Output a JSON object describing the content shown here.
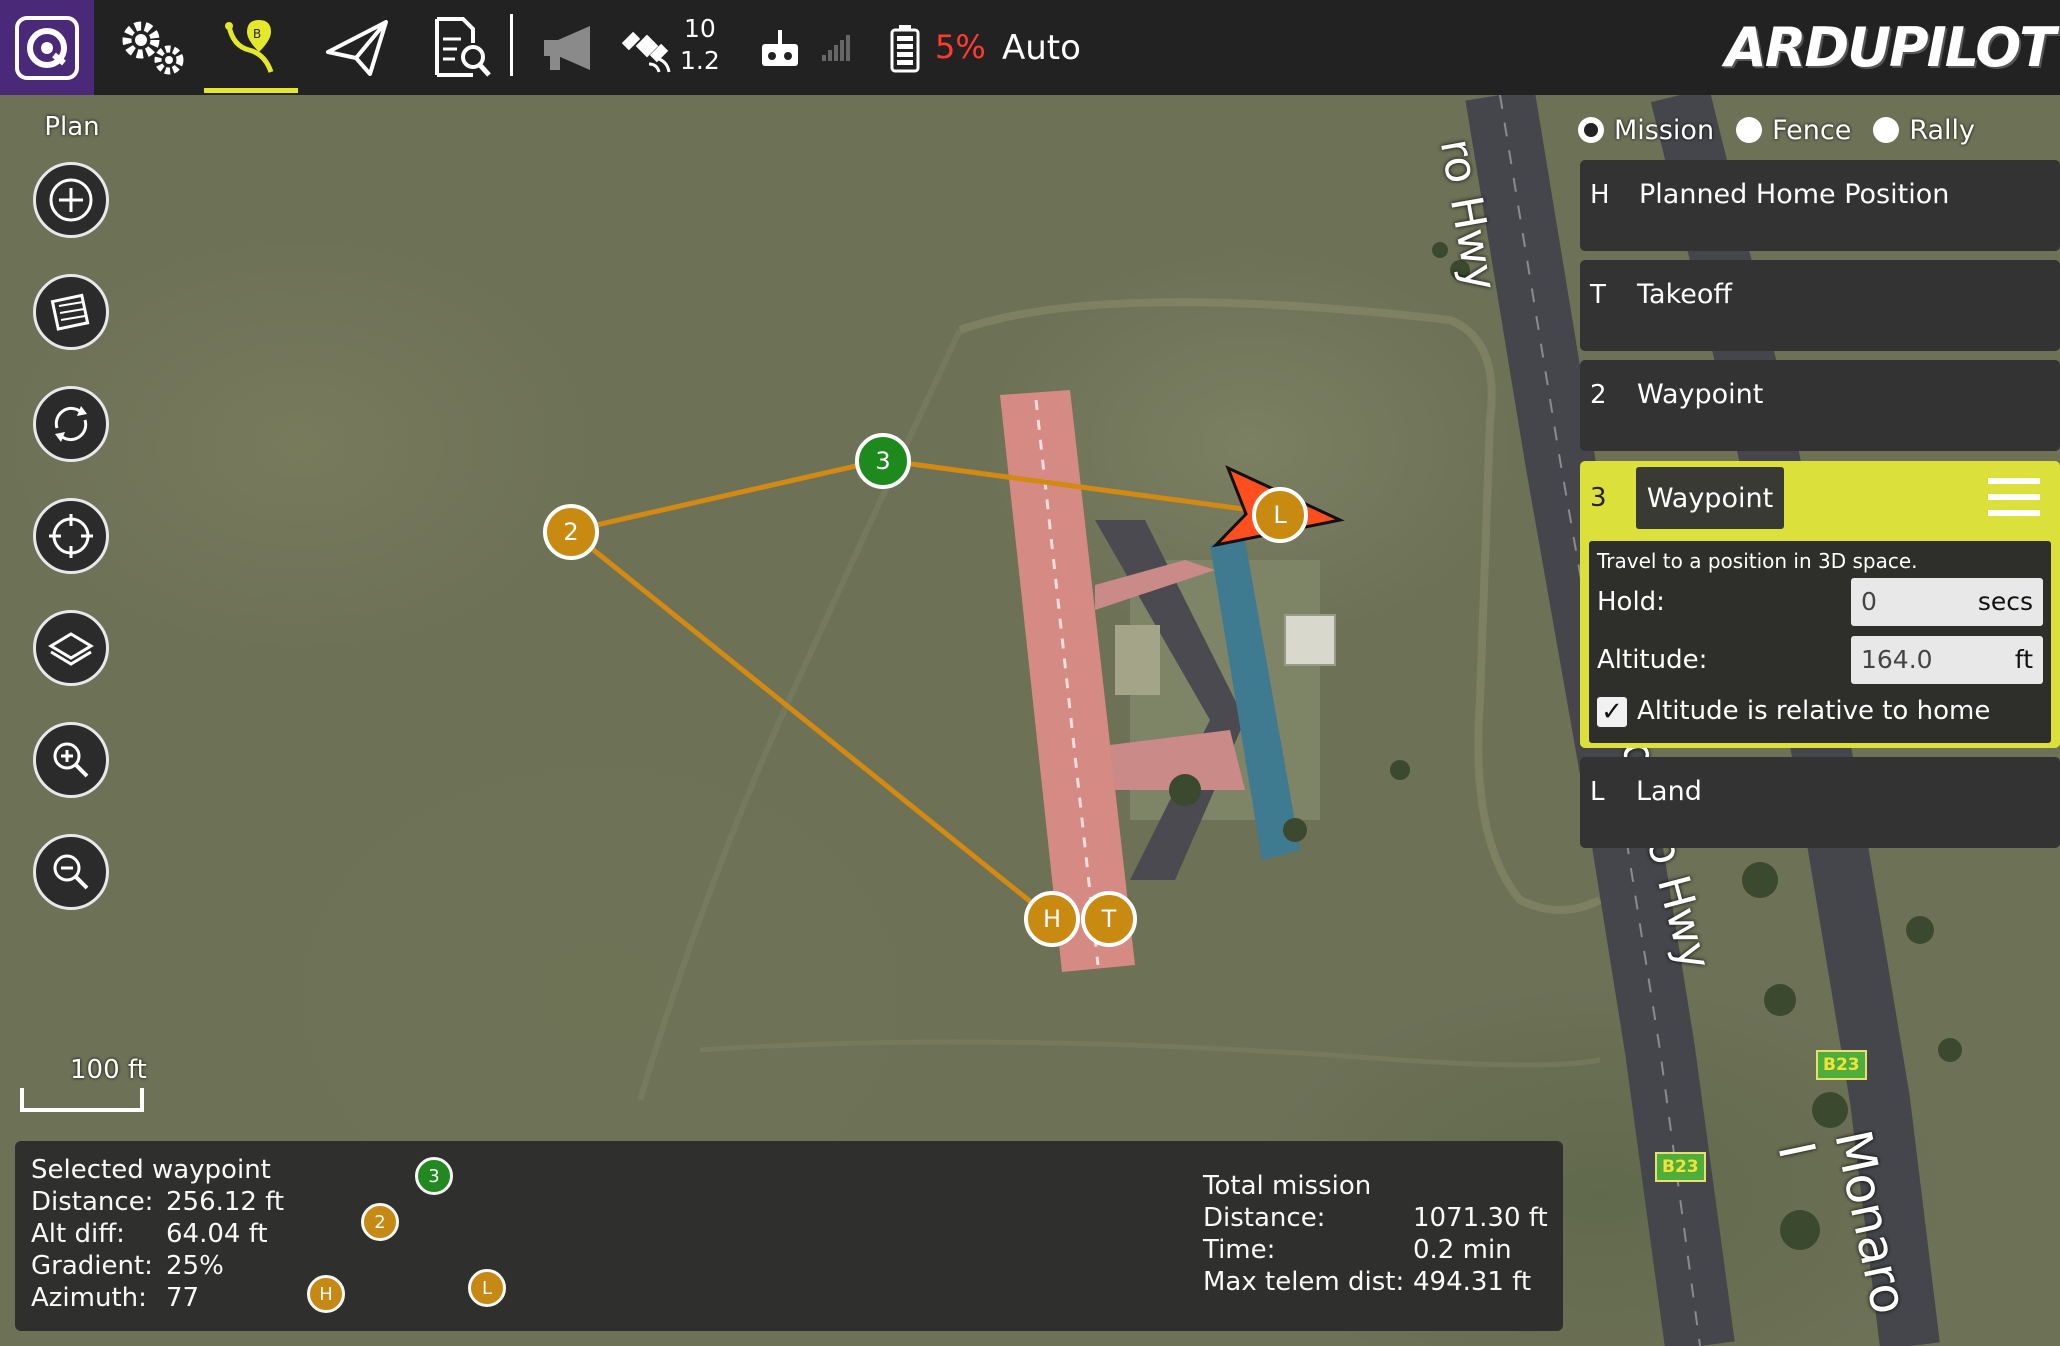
{
  "toolbar": {
    "satellite_count": "10",
    "hdop": "1.2",
    "battery_percent": "5%",
    "flight_mode": "Auto",
    "brand": "ARDUPILOT",
    "colors": {
      "background": "#222222",
      "active_underline": "#e4e82a",
      "battery_warning": "#ff3b30"
    },
    "icons": [
      "app-logo-icon",
      "gear-icon",
      "plan-icon",
      "fly-icon",
      "analyze-icon",
      "megaphone-icon",
      "satellite-icon",
      "rc-transmitter-icon",
      "signal-icon",
      "battery-icon"
    ]
  },
  "plan_tools": {
    "label": "Plan",
    "icons": [
      "add-waypoint-icon",
      "sync-icon",
      "pattern-icon",
      "center-icon",
      "layers-icon",
      "zoom-in-icon",
      "zoom-out-icon"
    ]
  },
  "map": {
    "scale_label": "100 ft",
    "road_labels": [
      "ro Hwy",
      "onaro Hwy",
      "Monaro I"
    ],
    "route_badges": [
      "B23",
      "B23"
    ],
    "markers": [
      {
        "label": "2",
        "color": "#c98a12"
      },
      {
        "label": "3",
        "color": "#1e8a1e"
      },
      {
        "label": "L",
        "color": "#c98a12"
      },
      {
        "label": "H",
        "color": "#c98a12"
      },
      {
        "label": "T",
        "color": "#c98a12"
      }
    ],
    "route_color": "#d38a12",
    "vehicle_color": "#ff4f1f"
  },
  "plan_type": {
    "options": [
      {
        "label": "Mission",
        "checked": true
      },
      {
        "label": "Fence",
        "checked": false
      },
      {
        "label": "Rally",
        "checked": false
      }
    ]
  },
  "mission_items": [
    {
      "index": "H",
      "title": "Planned Home Position"
    },
    {
      "index": "T",
      "title": "Takeoff"
    },
    {
      "index": "2",
      "title": "Waypoint"
    },
    {
      "index": "3",
      "title": "Waypoint"
    },
    {
      "index": "L",
      "title": "Land"
    }
  ],
  "selected_item": {
    "description": "Travel to a position in 3D space.",
    "hold_label": "Hold:",
    "hold_value": "0",
    "hold_unit": "secs",
    "altitude_label": "Altitude:",
    "altitude_value": "164.0",
    "altitude_unit": "ft",
    "relative_checkbox_label": "Altitude is relative to home",
    "relative_checked": true,
    "highlight_color": "#dbe03a"
  },
  "status": {
    "selected_title": "Selected waypoint",
    "distance_label": "Distance:",
    "distance_value": "256.12 ft",
    "alt_diff_label": "Alt diff:",
    "alt_diff_value": "64.04 ft",
    "gradient_label": "Gradient:",
    "gradient_value": "25%",
    "azimuth_label": "Azimuth:",
    "azimuth_value": "77",
    "total_title": "Total mission",
    "total_distance_label": "Distance:",
    "total_distance_value": "1071.30 ft",
    "time_label": "Time:",
    "time_value": "0.2 min",
    "max_telem_label": "Max telem dist:",
    "max_telem_value": "494.31 ft"
  }
}
